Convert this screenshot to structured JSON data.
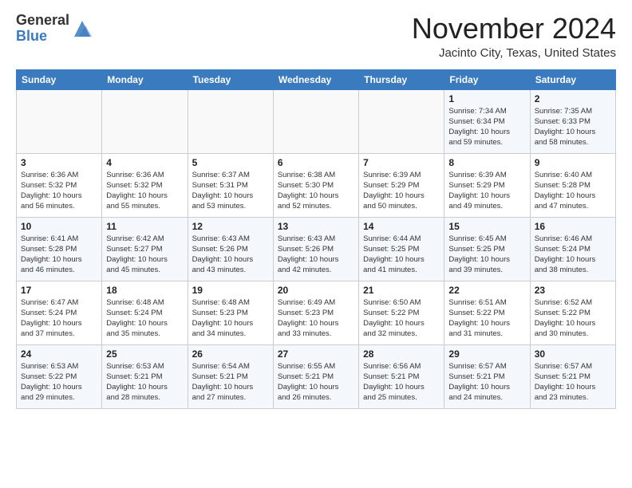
{
  "header": {
    "logo_general": "General",
    "logo_blue": "Blue",
    "month_title": "November 2024",
    "location": "Jacinto City, Texas, United States"
  },
  "calendar": {
    "weekdays": [
      "Sunday",
      "Monday",
      "Tuesday",
      "Wednesday",
      "Thursday",
      "Friday",
      "Saturday"
    ],
    "weeks": [
      [
        {
          "day": "",
          "info": ""
        },
        {
          "day": "",
          "info": ""
        },
        {
          "day": "",
          "info": ""
        },
        {
          "day": "",
          "info": ""
        },
        {
          "day": "",
          "info": ""
        },
        {
          "day": "1",
          "info": "Sunrise: 7:34 AM\nSunset: 6:34 PM\nDaylight: 10 hours\nand 59 minutes."
        },
        {
          "day": "2",
          "info": "Sunrise: 7:35 AM\nSunset: 6:33 PM\nDaylight: 10 hours\nand 58 minutes."
        }
      ],
      [
        {
          "day": "3",
          "info": "Sunrise: 6:36 AM\nSunset: 5:32 PM\nDaylight: 10 hours\nand 56 minutes."
        },
        {
          "day": "4",
          "info": "Sunrise: 6:36 AM\nSunset: 5:32 PM\nDaylight: 10 hours\nand 55 minutes."
        },
        {
          "day": "5",
          "info": "Sunrise: 6:37 AM\nSunset: 5:31 PM\nDaylight: 10 hours\nand 53 minutes."
        },
        {
          "day": "6",
          "info": "Sunrise: 6:38 AM\nSunset: 5:30 PM\nDaylight: 10 hours\nand 52 minutes."
        },
        {
          "day": "7",
          "info": "Sunrise: 6:39 AM\nSunset: 5:29 PM\nDaylight: 10 hours\nand 50 minutes."
        },
        {
          "day": "8",
          "info": "Sunrise: 6:39 AM\nSunset: 5:29 PM\nDaylight: 10 hours\nand 49 minutes."
        },
        {
          "day": "9",
          "info": "Sunrise: 6:40 AM\nSunset: 5:28 PM\nDaylight: 10 hours\nand 47 minutes."
        }
      ],
      [
        {
          "day": "10",
          "info": "Sunrise: 6:41 AM\nSunset: 5:28 PM\nDaylight: 10 hours\nand 46 minutes."
        },
        {
          "day": "11",
          "info": "Sunrise: 6:42 AM\nSunset: 5:27 PM\nDaylight: 10 hours\nand 45 minutes."
        },
        {
          "day": "12",
          "info": "Sunrise: 6:43 AM\nSunset: 5:26 PM\nDaylight: 10 hours\nand 43 minutes."
        },
        {
          "day": "13",
          "info": "Sunrise: 6:43 AM\nSunset: 5:26 PM\nDaylight: 10 hours\nand 42 minutes."
        },
        {
          "day": "14",
          "info": "Sunrise: 6:44 AM\nSunset: 5:25 PM\nDaylight: 10 hours\nand 41 minutes."
        },
        {
          "day": "15",
          "info": "Sunrise: 6:45 AM\nSunset: 5:25 PM\nDaylight: 10 hours\nand 39 minutes."
        },
        {
          "day": "16",
          "info": "Sunrise: 6:46 AM\nSunset: 5:24 PM\nDaylight: 10 hours\nand 38 minutes."
        }
      ],
      [
        {
          "day": "17",
          "info": "Sunrise: 6:47 AM\nSunset: 5:24 PM\nDaylight: 10 hours\nand 37 minutes."
        },
        {
          "day": "18",
          "info": "Sunrise: 6:48 AM\nSunset: 5:24 PM\nDaylight: 10 hours\nand 35 minutes."
        },
        {
          "day": "19",
          "info": "Sunrise: 6:48 AM\nSunset: 5:23 PM\nDaylight: 10 hours\nand 34 minutes."
        },
        {
          "day": "20",
          "info": "Sunrise: 6:49 AM\nSunset: 5:23 PM\nDaylight: 10 hours\nand 33 minutes."
        },
        {
          "day": "21",
          "info": "Sunrise: 6:50 AM\nSunset: 5:22 PM\nDaylight: 10 hours\nand 32 minutes."
        },
        {
          "day": "22",
          "info": "Sunrise: 6:51 AM\nSunset: 5:22 PM\nDaylight: 10 hours\nand 31 minutes."
        },
        {
          "day": "23",
          "info": "Sunrise: 6:52 AM\nSunset: 5:22 PM\nDaylight: 10 hours\nand 30 minutes."
        }
      ],
      [
        {
          "day": "24",
          "info": "Sunrise: 6:53 AM\nSunset: 5:22 PM\nDaylight: 10 hours\nand 29 minutes."
        },
        {
          "day": "25",
          "info": "Sunrise: 6:53 AM\nSunset: 5:21 PM\nDaylight: 10 hours\nand 28 minutes."
        },
        {
          "day": "26",
          "info": "Sunrise: 6:54 AM\nSunset: 5:21 PM\nDaylight: 10 hours\nand 27 minutes."
        },
        {
          "day": "27",
          "info": "Sunrise: 6:55 AM\nSunset: 5:21 PM\nDaylight: 10 hours\nand 26 minutes."
        },
        {
          "day": "28",
          "info": "Sunrise: 6:56 AM\nSunset: 5:21 PM\nDaylight: 10 hours\nand 25 minutes."
        },
        {
          "day": "29",
          "info": "Sunrise: 6:57 AM\nSunset: 5:21 PM\nDaylight: 10 hours\nand 24 minutes."
        },
        {
          "day": "30",
          "info": "Sunrise: 6:57 AM\nSunset: 5:21 PM\nDaylight: 10 hours\nand 23 minutes."
        }
      ]
    ]
  }
}
